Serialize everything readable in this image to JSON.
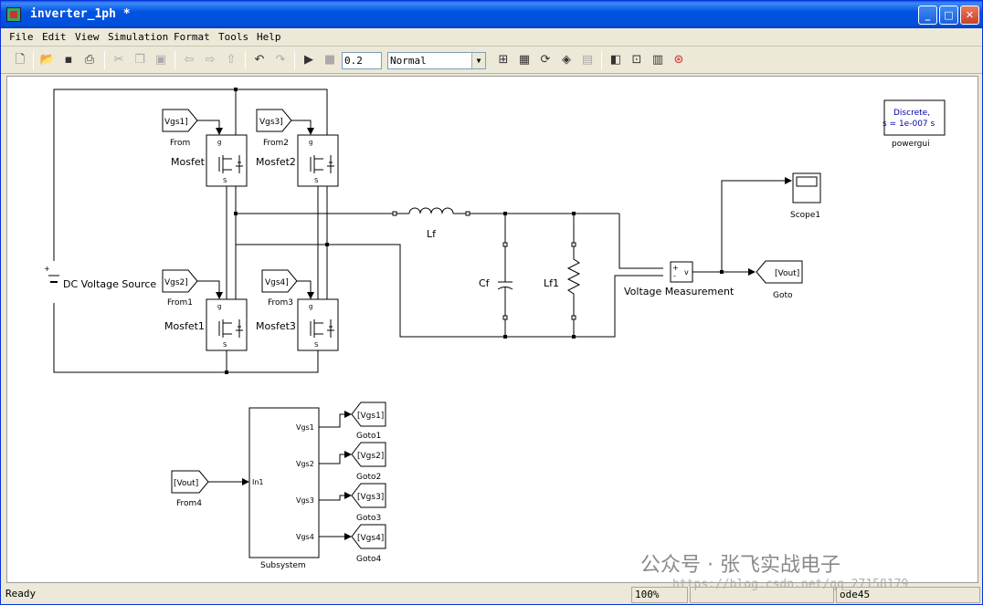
{
  "window": {
    "title": "inverter_1ph *"
  },
  "title_buttons": {
    "minimize": "_",
    "maximize": "□",
    "close": "✕"
  },
  "menu": [
    "File",
    "Edit",
    "View",
    "Simulation",
    "Format",
    "Tools",
    "Help"
  ],
  "toolbar": {
    "stop_time": "0.2",
    "sim_mode": "Normal",
    "icons": [
      "new-icon",
      "open-icon",
      "save-icon",
      "print-icon",
      "cut-icon",
      "copy-icon",
      "paste-icon",
      "back-icon",
      "forward-icon",
      "up-icon",
      "undo-icon",
      "redo-icon",
      "run-icon",
      "stop-icon",
      "build-icon",
      "library-icon",
      "update-icon",
      "model-explorer-icon",
      "debug-icon",
      "sim-target-icon",
      "zoom-icon",
      "model-browser-icon",
      "record-icon"
    ]
  },
  "blocks": {
    "from": "From",
    "from1": "From1",
    "from2": "From2",
    "from3": "From3",
    "from4": "From4",
    "vgs1_tag": "Vgs1]",
    "vgs2_tag": "Vgs2]",
    "vgs3_tag": "Vgs3]",
    "vgs4_tag": "Vgs4]",
    "vout_tag": "[Vout]",
    "mosfet": "Mosfet",
    "mosfet1": "Mosfet1",
    "mosfet2": "Mosfet2",
    "mosfet3": "Mosfet3",
    "dc_source": "DC Voltage Source",
    "lf": "Lf",
    "cf": "Cf",
    "lf1": "Lf1",
    "voltage_meas": "Voltage Measurement",
    "scope1": "Scope1",
    "goto": "Goto",
    "goto1": "Goto1",
    "goto2": "Goto2",
    "goto3": "Goto3",
    "goto4": "Goto4",
    "goto_vout": "[Vout]",
    "goto_vgs1": "[Vgs1]",
    "goto_vgs2": "[Vgs2]",
    "goto_vgs3": "[Vgs3]",
    "goto_vgs4": "[Vgs4]",
    "powergui_line1": "Discrete,",
    "powergui_line2": "s = 1e-007 s",
    "powergui": "powergui",
    "subsystem": "Subsystem",
    "sub_in1": "In1",
    "sub_out1": "Vgs1",
    "sub_out2": "Vgs2",
    "sub_out3": "Vgs3",
    "sub_out4": "Vgs4",
    "pin_g": "g",
    "pin_s": "S",
    "vm_plus": "+",
    "vm_minus": "-",
    "vm_v": "v"
  },
  "status": {
    "ready": "Ready",
    "zoom": "100%",
    "solver": "ode45"
  },
  "watermark": {
    "text": "公众号 · 张飞实战电子",
    "url": "https://blog.csdn.net/qq_27158179"
  }
}
